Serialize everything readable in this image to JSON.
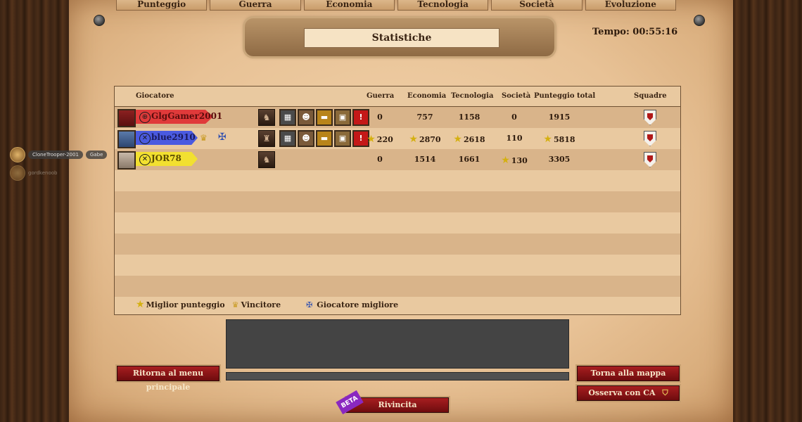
{
  "tabs": [
    "Punteggio",
    "Guerra",
    "Economia",
    "Tecnologia",
    "Società",
    "Evoluzione"
  ],
  "title": "Statistiche",
  "timer": "Tempo: 00:55:16",
  "side_players": [
    {
      "name": "CloneTrooper-2001",
      "tag": "Gabe"
    },
    {
      "name": "gordkenoob"
    }
  ],
  "table": {
    "headers": {
      "player": "Giocatore",
      "war": "Guerra",
      "economy": "Economia",
      "tech": "Tecnologia",
      "society": "Società",
      "total": "Punteggio total",
      "teams": "Squadre"
    },
    "rows": [
      {
        "name": "GlgGamer2001",
        "color": "red",
        "war": "0",
        "economy": "757",
        "tech": "1158",
        "society": "0",
        "total": "1915",
        "team": "1"
      },
      {
        "name": "blue2910",
        "color": "blue",
        "war": "220",
        "economy": "2870",
        "tech": "2618",
        "society": "110",
        "total": "5818",
        "team": "2"
      },
      {
        "name": "JOR78",
        "color": "yellow",
        "war": "0",
        "economy": "1514",
        "tech": "1661",
        "society": "130",
        "total": "3305",
        "team": "3"
      }
    ]
  },
  "legend": {
    "best_score": "Miglior punteggio",
    "winner": "Vincitore",
    "best_player": "Giocatore migliore"
  },
  "buttons": {
    "main_menu": "Ritorna al menu principale",
    "back_to_map": "Torna alla mappa",
    "watch_ca": "Osserva con CA",
    "rematch": "Rivincita",
    "beta": "BETA"
  },
  "colors": {
    "button": "#8b1416",
    "parchment": "#e9c9a0"
  }
}
